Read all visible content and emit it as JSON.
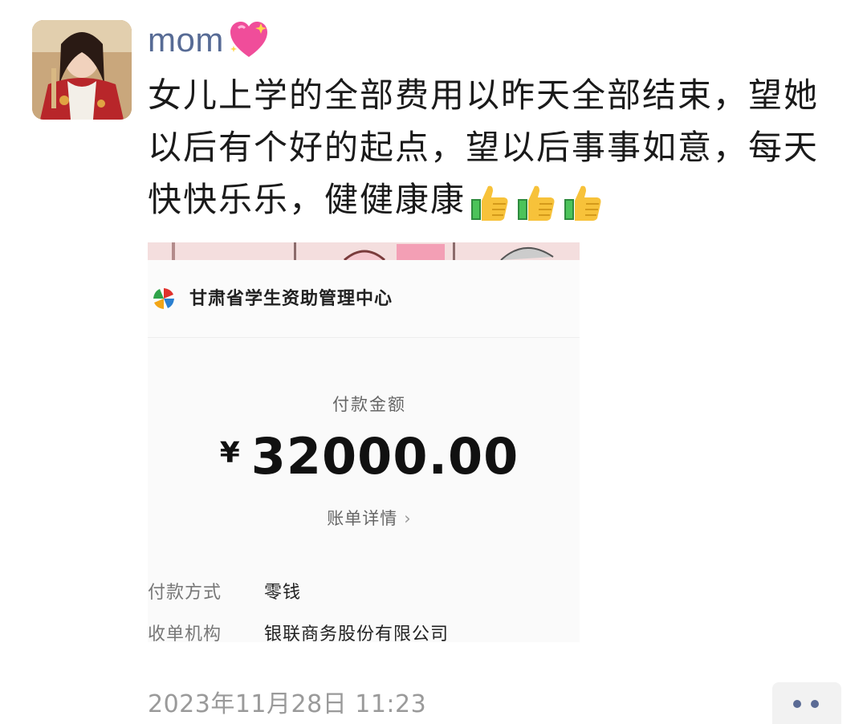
{
  "post": {
    "author": "mom",
    "author_emoji": "sparkling-heart",
    "message": "女儿上学的全部费用以昨天全部结束，望她以后有个好的起点，望以后事事如意，每天快快乐乐，健健康康",
    "trailing_emoji": [
      "thumbs-up",
      "thumbs-up",
      "thumbs-up"
    ],
    "timestamp": "2023年11月28日  11:23"
  },
  "receipt": {
    "organization": "甘肃省学生资助管理中心",
    "amount_label": "付款金额",
    "currency": "¥",
    "amount": "32000.00",
    "detail_link": "账单详情",
    "rows": [
      {
        "label": "付款方式",
        "value": "零钱"
      },
      {
        "label": "收单机构",
        "value": "银联商务股份有限公司"
      }
    ]
  },
  "colors": {
    "author_name": "#576b95",
    "timestamp": "#9a9a9a",
    "more_dots": "#5b6b95"
  }
}
